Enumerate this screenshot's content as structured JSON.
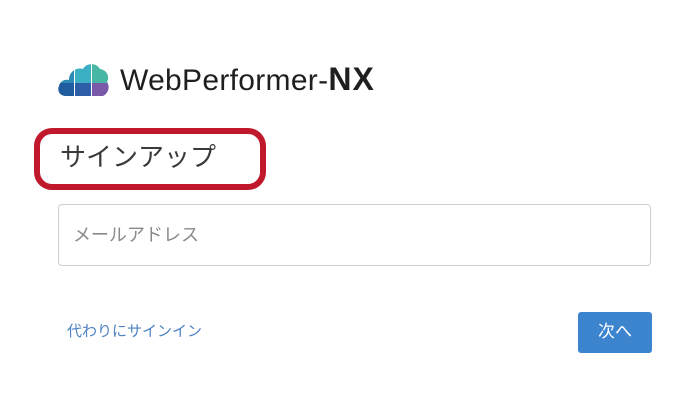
{
  "logo": {
    "brand_text": "WebPerformer",
    "brand_separator": "-",
    "brand_suffix": "NX",
    "icon": "cloud-logo-icon"
  },
  "signup": {
    "title": "サインアップ",
    "email_placeholder": "メールアドレス",
    "email_value": "",
    "alt_signin_link": "代わりにサインイン",
    "next_button": "次へ"
  },
  "annotation": {
    "highlight_color": "#c0192b"
  },
  "colors": {
    "primary": "#3d84cf",
    "link": "#4f82c2",
    "logo_teal": "#3bb0c4",
    "logo_blue": "#2e5ea8",
    "logo_purple": "#7a5aa8"
  }
}
